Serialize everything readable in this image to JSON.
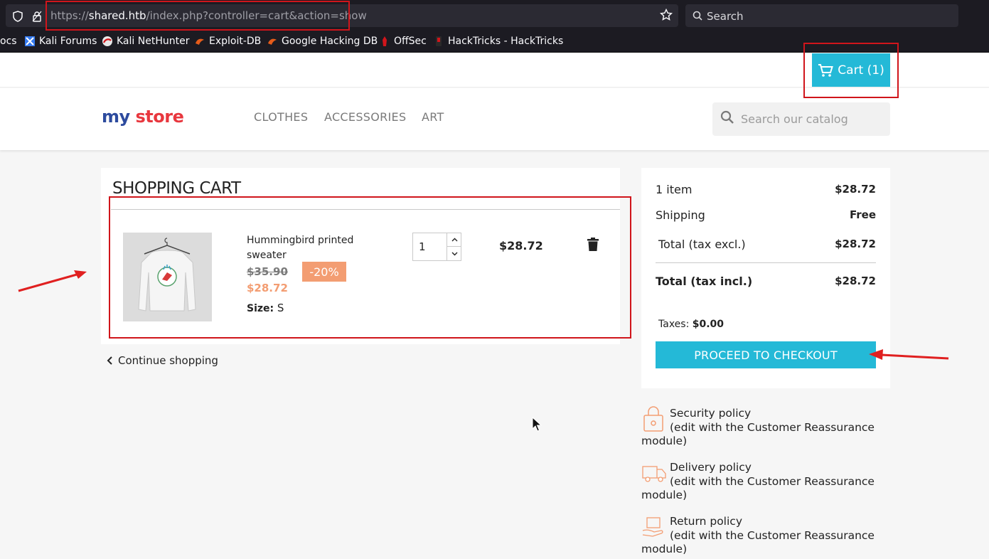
{
  "browser": {
    "url_prefix": "https://",
    "url_host": "shared.htb",
    "url_path": "/index.php?controller=cart&action=show",
    "search_placeholder": "Search",
    "bookmarks": [
      {
        "label": "ocs",
        "icon": "bookmark-icon"
      },
      {
        "label": "Kali Forums",
        "icon": "kali-forums-icon"
      },
      {
        "label": "Kali NetHunter",
        "icon": "kali-nethunter-icon"
      },
      {
        "label": "Exploit-DB",
        "icon": "exploit-db-icon"
      },
      {
        "label": "Google Hacking DB",
        "icon": "exploit-db-icon"
      },
      {
        "label": "OffSec",
        "icon": "offsec-icon"
      },
      {
        "label": "HackTricks - HackTricks",
        "icon": "hacktricks-icon"
      }
    ]
  },
  "store": {
    "cart_button_label": "Cart (1)",
    "logo": {
      "word1": "my",
      "word2": "store"
    },
    "nav": [
      "CLOTHES",
      "ACCESSORIES",
      "ART"
    ],
    "search_placeholder": "Search our catalog"
  },
  "cart": {
    "title": "SHOPPING CART",
    "item": {
      "name": "Hummingbird printed sweater",
      "old_price": "$35.90",
      "discount": "-20%",
      "price": "$28.72",
      "size_label": "Size:",
      "size_value": "S",
      "quantity": "1",
      "line_total": "$28.72"
    },
    "continue_label": "Continue shopping"
  },
  "summary": {
    "items_label": "1 item",
    "items_value": "$28.72",
    "shipping_label": "Shipping",
    "shipping_value": "Free",
    "total_excl_label": "Total (tax excl.)",
    "total_excl_value": "$28.72",
    "total_incl_label": "Total (tax incl.)",
    "total_incl_value": "$28.72",
    "taxes_label": "Taxes:",
    "taxes_value": "$0.00",
    "checkout_label": "PROCEED TO CHECKOUT"
  },
  "reassurance": [
    {
      "title": "Security policy",
      "desc": "(edit with the Customer Reassurance module)",
      "icon": "security-icon"
    },
    {
      "title": "Delivery policy",
      "desc": "(edit with the Customer Reassurance module)",
      "icon": "delivery-truck-icon"
    },
    {
      "title": "Return policy",
      "desc": "(edit with the Customer Reassurance module)",
      "icon": "return-box-icon"
    }
  ],
  "colors": {
    "accent": "#24b9d7",
    "discount": "#f39d72",
    "annotation_red": "#d0151b"
  }
}
